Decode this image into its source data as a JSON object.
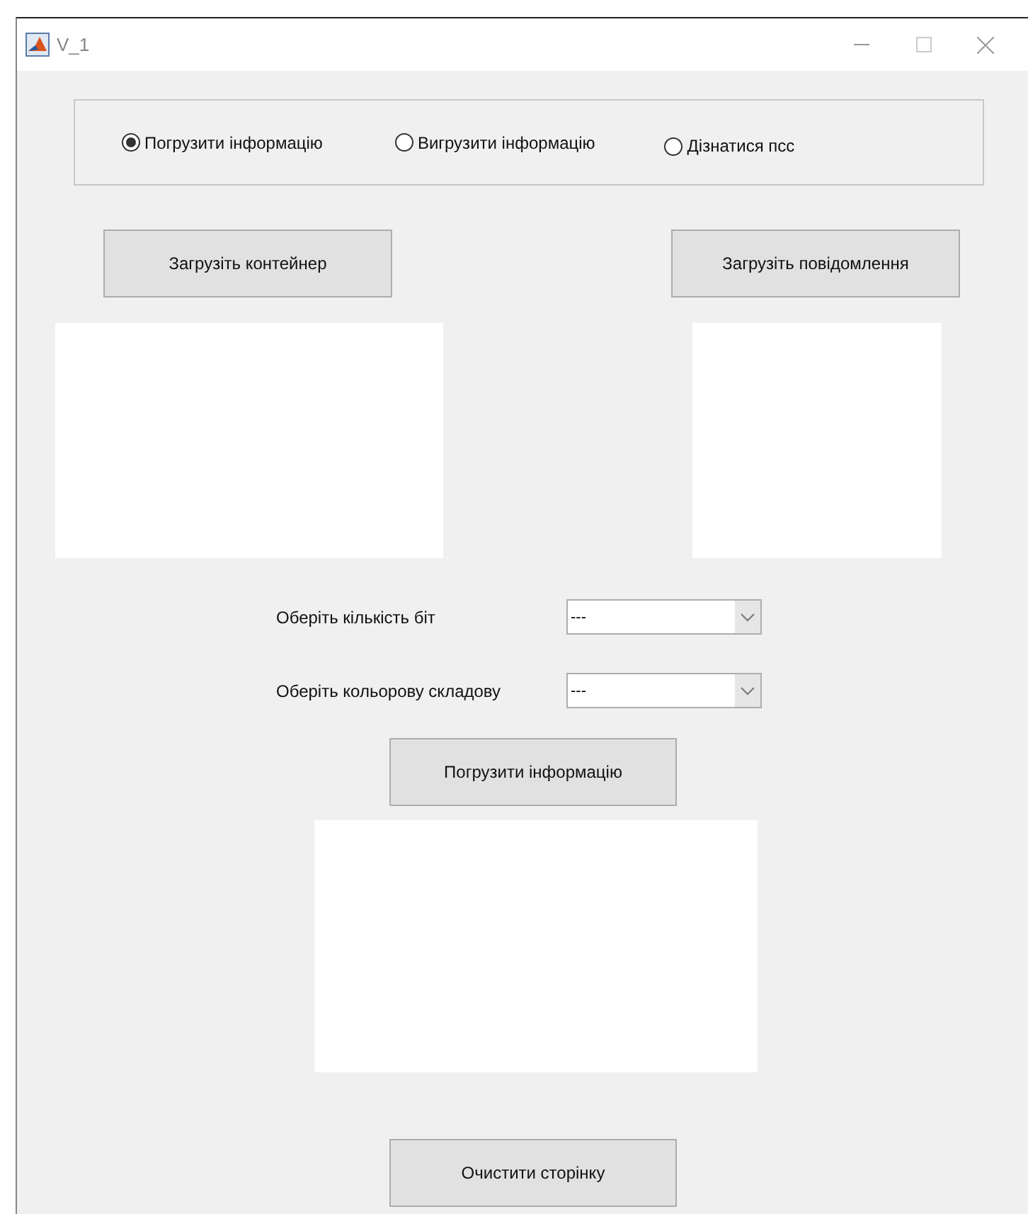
{
  "window": {
    "title": "V_1"
  },
  "mode_options": [
    {
      "label": "Погрузити інформацію",
      "selected": true
    },
    {
      "label": "Вигрузити інформацію",
      "selected": false
    },
    {
      "label": "Дізнатися псс",
      "selected": false
    }
  ],
  "load_container_button": "Загрузіть контейнер",
  "load_message_button": "Загрузіть повідомлення",
  "bits_select": {
    "label": "Оберіть кількість біт",
    "value": "---"
  },
  "channel_select": {
    "label": "Оберіть кольорову складову",
    "value": "---"
  },
  "embed_button": "Погрузити інформацію",
  "clear_button": "Очистити сторінку"
}
